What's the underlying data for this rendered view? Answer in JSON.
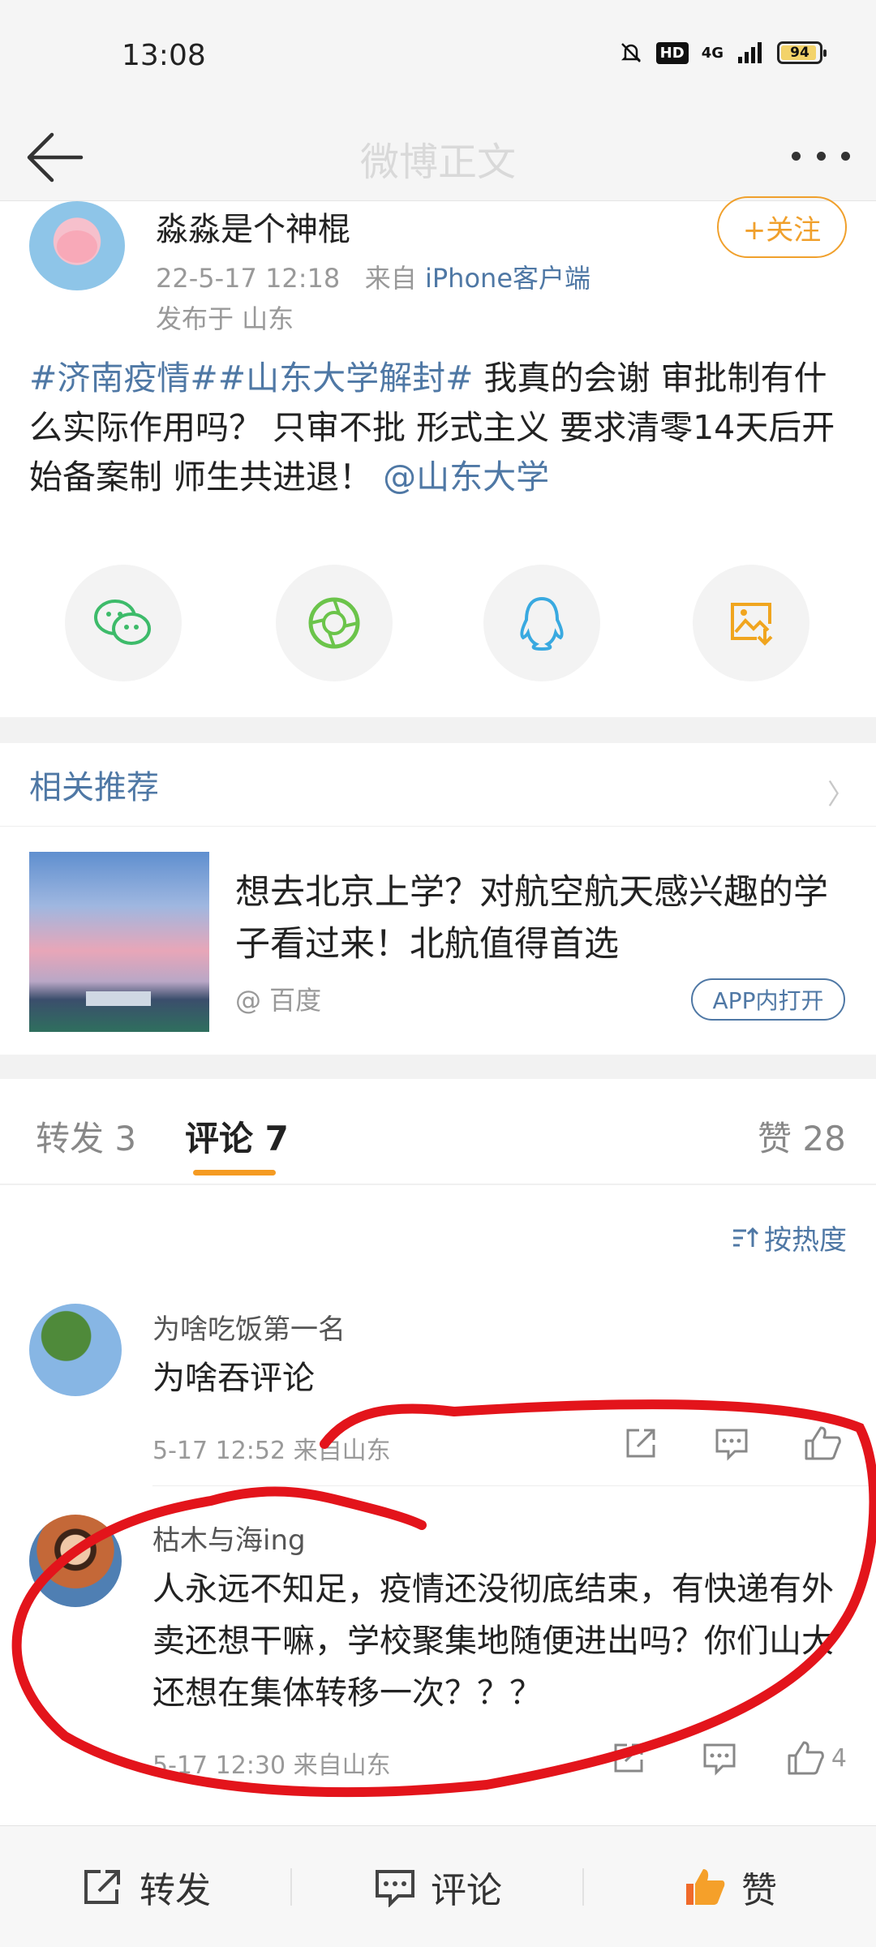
{
  "status_bar": {
    "time": "13:08",
    "network": "4G",
    "battery": 94
  },
  "nav": {
    "title": "微博正文"
  },
  "post": {
    "author": "淼淼是个神棍",
    "follow_label": "+关注",
    "date": "22-5-17 12:18",
    "from_prefix": "来自",
    "source": "iPhone客户端",
    "location": "发布于 山东",
    "text_tag1": "#济南疫情#",
    "text_tag2": "#山东大学解封#",
    "text_body": " 我真的会谢 审批制有什么实际作用吗？ 只审不批 形式主义 要求清零14天后开始备案制 师生共进退！",
    "text_mention": "@山东大学"
  },
  "share_icons": [
    "wechat-icon",
    "moments-icon",
    "qq-icon",
    "save-image-icon"
  ],
  "related": {
    "title": "相关推荐",
    "headline": "想去北京上学？对航空航天感兴趣的学子看过来！北航值得首选",
    "source": "@ 百度",
    "app_button": "APP内打开"
  },
  "tabs": {
    "repost": "转发 3",
    "comment": "评论 7",
    "like": "赞 28"
  },
  "sort_label": "按热度",
  "comments": [
    {
      "name": "为啥吃饭第一名",
      "text": "为啥吞评论",
      "meta": "5-17 12:52  来自山东",
      "likes": ""
    },
    {
      "name": "枯木与海ing",
      "text": "人永远不知足，疫情还没彻底结束，有快递有外卖还想干嘛，学校聚集地随便进出吗？你们山大还想在集体转移一次？？？",
      "meta": "5-17 12:30  来自山东",
      "likes": "4"
    }
  ],
  "bottom_bar": {
    "repost": "转发",
    "comment": "评论",
    "like": "赞"
  },
  "colors": {
    "link": "#4f78a5",
    "accent": "#f59b22",
    "annotation": "#e3141b"
  }
}
